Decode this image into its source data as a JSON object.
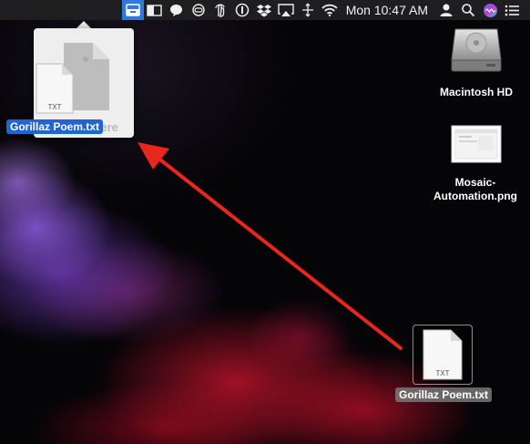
{
  "menubar": {
    "clock": "Mon 10:47 AM",
    "status_icons": [
      "drop-tray-icon",
      "window-layout-icon",
      "speech-bubble-icon",
      "tray-toggle-icon",
      "touch-icon",
      "password-manager-icon",
      "dropbox-icon",
      "airplay-icon",
      "move-icon",
      "wifi-icon",
      "user-icon",
      "spotlight-search-icon",
      "siri-icon",
      "notification-center-icon"
    ],
    "active_item": "drop-tray-icon",
    "active_color": "#2f78d8"
  },
  "drop_panel": {
    "hint_text": "Here",
    "dragged_file": {
      "name": "Gorillaz Poem.txt",
      "type": "TXT"
    }
  },
  "desktop": {
    "items": [
      {
        "name": "Macintosh HD",
        "kind": "drive"
      },
      {
        "name": "Mosaic-\nAutomation.png",
        "kind": "image"
      },
      {
        "name": "Gorillaz Poem.txt",
        "kind": "text",
        "type": "TXT"
      }
    ]
  },
  "annotation": {
    "color": "#e8261c"
  }
}
